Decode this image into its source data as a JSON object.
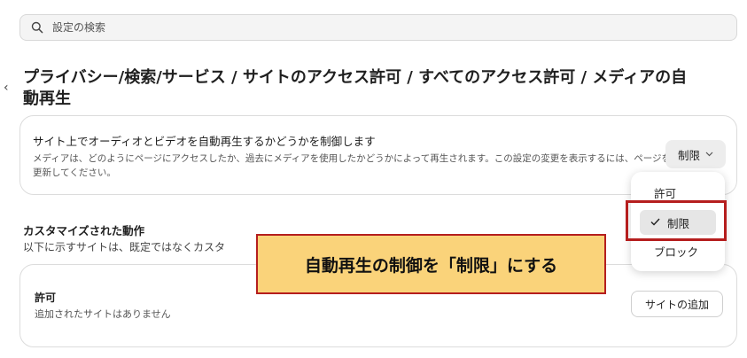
{
  "search": {
    "placeholder": "設定の検索"
  },
  "nav": {
    "back_glyph": "‹"
  },
  "page": {
    "title": "プライバシー/検索/サービス / サイトのアクセス許可 / すべてのアクセス許可 / メディアの自動再生"
  },
  "autoplay": {
    "title": "サイト上でオーディオとビデオを自動再生するかどうかを制御します",
    "description": "メディアは、どのようにページにアクセスしたか、過去にメディアを使用したかどうかによって再生されます。この設定の変更を表示するには、ページを更新してください。",
    "selected_value": "制限",
    "options": [
      "許可",
      "制限",
      "ブロック"
    ]
  },
  "custom": {
    "title": "カスタマイズされた動作",
    "description": "以下に示すサイトは、既定ではなくカスタ"
  },
  "allow_card": {
    "title": "許可",
    "empty_text": "追加されたサイトはありません",
    "add_button": "サイトの追加"
  },
  "annotation": {
    "callout_text": "自動再生の制御を「制限」にする"
  },
  "colors": {
    "highlight_border": "#b51e1e",
    "callout_bg": "#fad37a"
  },
  "icons": {
    "search": "search-icon",
    "check": "check-icon",
    "chevron": "chevron-down-icon",
    "back": "back-icon"
  }
}
